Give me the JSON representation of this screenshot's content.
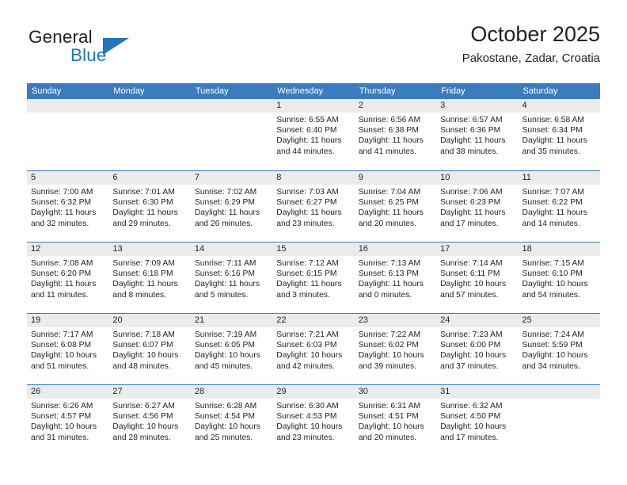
{
  "brand": {
    "name_top": "General",
    "name_bottom": "Blue",
    "accent_color": "#1f76bc"
  },
  "header": {
    "title": "October 2025",
    "subtitle": "Pakostane, Zadar, Croatia"
  },
  "calendar": {
    "header_bg": "#3a7cbe",
    "daynum_bg": "#ebebeb",
    "weekdays": [
      "Sunday",
      "Monday",
      "Tuesday",
      "Wednesday",
      "Thursday",
      "Friday",
      "Saturday"
    ],
    "weeks": [
      [
        {
          "day": "",
          "lines": []
        },
        {
          "day": "",
          "lines": []
        },
        {
          "day": "",
          "lines": []
        },
        {
          "day": "1",
          "lines": [
            "Sunrise: 6:55 AM",
            "Sunset: 6:40 PM",
            "Daylight: 11 hours and 44 minutes."
          ]
        },
        {
          "day": "2",
          "lines": [
            "Sunrise: 6:56 AM",
            "Sunset: 6:38 PM",
            "Daylight: 11 hours and 41 minutes."
          ]
        },
        {
          "day": "3",
          "lines": [
            "Sunrise: 6:57 AM",
            "Sunset: 6:36 PM",
            "Daylight: 11 hours and 38 minutes."
          ]
        },
        {
          "day": "4",
          "lines": [
            "Sunrise: 6:58 AM",
            "Sunset: 6:34 PM",
            "Daylight: 11 hours and 35 minutes."
          ]
        }
      ],
      [
        {
          "day": "5",
          "lines": [
            "Sunrise: 7:00 AM",
            "Sunset: 6:32 PM",
            "Daylight: 11 hours and 32 minutes."
          ]
        },
        {
          "day": "6",
          "lines": [
            "Sunrise: 7:01 AM",
            "Sunset: 6:30 PM",
            "Daylight: 11 hours and 29 minutes."
          ]
        },
        {
          "day": "7",
          "lines": [
            "Sunrise: 7:02 AM",
            "Sunset: 6:29 PM",
            "Daylight: 11 hours and 26 minutes."
          ]
        },
        {
          "day": "8",
          "lines": [
            "Sunrise: 7:03 AM",
            "Sunset: 6:27 PM",
            "Daylight: 11 hours and 23 minutes."
          ]
        },
        {
          "day": "9",
          "lines": [
            "Sunrise: 7:04 AM",
            "Sunset: 6:25 PM",
            "Daylight: 11 hours and 20 minutes."
          ]
        },
        {
          "day": "10",
          "lines": [
            "Sunrise: 7:06 AM",
            "Sunset: 6:23 PM",
            "Daylight: 11 hours and 17 minutes."
          ]
        },
        {
          "day": "11",
          "lines": [
            "Sunrise: 7:07 AM",
            "Sunset: 6:22 PM",
            "Daylight: 11 hours and 14 minutes."
          ]
        }
      ],
      [
        {
          "day": "12",
          "lines": [
            "Sunrise: 7:08 AM",
            "Sunset: 6:20 PM",
            "Daylight: 11 hours and 11 minutes."
          ]
        },
        {
          "day": "13",
          "lines": [
            "Sunrise: 7:09 AM",
            "Sunset: 6:18 PM",
            "Daylight: 11 hours and 8 minutes."
          ]
        },
        {
          "day": "14",
          "lines": [
            "Sunrise: 7:11 AM",
            "Sunset: 6:16 PM",
            "Daylight: 11 hours and 5 minutes."
          ]
        },
        {
          "day": "15",
          "lines": [
            "Sunrise: 7:12 AM",
            "Sunset: 6:15 PM",
            "Daylight: 11 hours and 3 minutes."
          ]
        },
        {
          "day": "16",
          "lines": [
            "Sunrise: 7:13 AM",
            "Sunset: 6:13 PM",
            "Daylight: 11 hours and 0 minutes."
          ]
        },
        {
          "day": "17",
          "lines": [
            "Sunrise: 7:14 AM",
            "Sunset: 6:11 PM",
            "Daylight: 10 hours and 57 minutes."
          ]
        },
        {
          "day": "18",
          "lines": [
            "Sunrise: 7:15 AM",
            "Sunset: 6:10 PM",
            "Daylight: 10 hours and 54 minutes."
          ]
        }
      ],
      [
        {
          "day": "19",
          "lines": [
            "Sunrise: 7:17 AM",
            "Sunset: 6:08 PM",
            "Daylight: 10 hours and 51 minutes."
          ]
        },
        {
          "day": "20",
          "lines": [
            "Sunrise: 7:18 AM",
            "Sunset: 6:07 PM",
            "Daylight: 10 hours and 48 minutes."
          ]
        },
        {
          "day": "21",
          "lines": [
            "Sunrise: 7:19 AM",
            "Sunset: 6:05 PM",
            "Daylight: 10 hours and 45 minutes."
          ]
        },
        {
          "day": "22",
          "lines": [
            "Sunrise: 7:21 AM",
            "Sunset: 6:03 PM",
            "Daylight: 10 hours and 42 minutes."
          ]
        },
        {
          "day": "23",
          "lines": [
            "Sunrise: 7:22 AM",
            "Sunset: 6:02 PM",
            "Daylight: 10 hours and 39 minutes."
          ]
        },
        {
          "day": "24",
          "lines": [
            "Sunrise: 7:23 AM",
            "Sunset: 6:00 PM",
            "Daylight: 10 hours and 37 minutes."
          ]
        },
        {
          "day": "25",
          "lines": [
            "Sunrise: 7:24 AM",
            "Sunset: 5:59 PM",
            "Daylight: 10 hours and 34 minutes."
          ]
        }
      ],
      [
        {
          "day": "26",
          "lines": [
            "Sunrise: 6:26 AM",
            "Sunset: 4:57 PM",
            "Daylight: 10 hours and 31 minutes."
          ]
        },
        {
          "day": "27",
          "lines": [
            "Sunrise: 6:27 AM",
            "Sunset: 4:56 PM",
            "Daylight: 10 hours and 28 minutes."
          ]
        },
        {
          "day": "28",
          "lines": [
            "Sunrise: 6:28 AM",
            "Sunset: 4:54 PM",
            "Daylight: 10 hours and 25 minutes."
          ]
        },
        {
          "day": "29",
          "lines": [
            "Sunrise: 6:30 AM",
            "Sunset: 4:53 PM",
            "Daylight: 10 hours and 23 minutes."
          ]
        },
        {
          "day": "30",
          "lines": [
            "Sunrise: 6:31 AM",
            "Sunset: 4:51 PM",
            "Daylight: 10 hours and 20 minutes."
          ]
        },
        {
          "day": "31",
          "lines": [
            "Sunrise: 6:32 AM",
            "Sunset: 4:50 PM",
            "Daylight: 10 hours and 17 minutes."
          ]
        },
        {
          "day": "",
          "lines": []
        }
      ]
    ]
  }
}
